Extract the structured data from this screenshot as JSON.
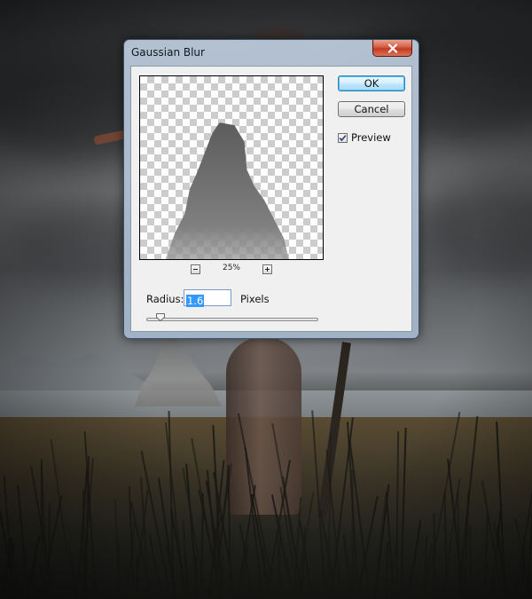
{
  "dialog": {
    "title": "Gaussian Blur",
    "ok_label": "OK",
    "cancel_label": "Cancel",
    "preview_label": "Preview",
    "preview_checked": true,
    "zoom_level": "25%",
    "radius_label": "Radius:",
    "radius_value": "1.6",
    "radius_units": "Pixels",
    "radius_slider_fraction": 0.08
  },
  "icons": {
    "close": "close-icon",
    "zoom_out": "minus-icon",
    "zoom_in": "plus-icon",
    "check": "checkmark-icon"
  },
  "colors": {
    "close_button": "#c23b22",
    "ok_button_border": "#3c7fb1",
    "selection": "#3399ff"
  }
}
